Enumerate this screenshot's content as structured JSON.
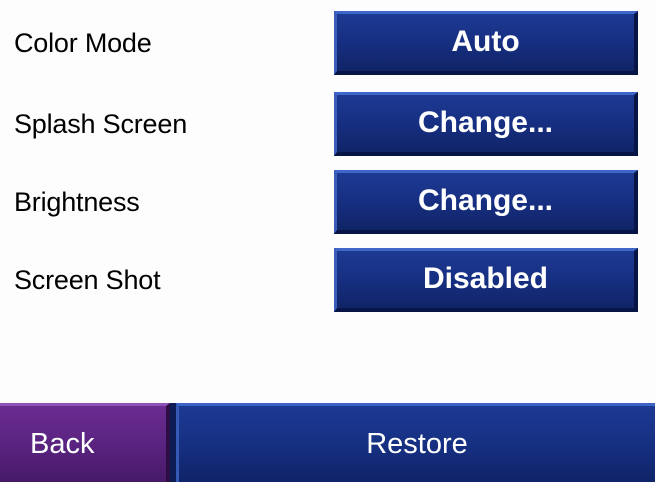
{
  "settings": {
    "rows": [
      {
        "label": "Color Mode",
        "value": "Auto"
      },
      {
        "label": "Splash Screen",
        "value": "Change..."
      },
      {
        "label": "Brightness",
        "value": "Change..."
      },
      {
        "label": "Screen Shot",
        "value": "Disabled"
      }
    ]
  },
  "footer": {
    "back_label": "Back",
    "restore_label": "Restore"
  },
  "colors": {
    "button_blue": "#173084",
    "back_purple": "#5a2380",
    "background": "#fdfdfd"
  }
}
